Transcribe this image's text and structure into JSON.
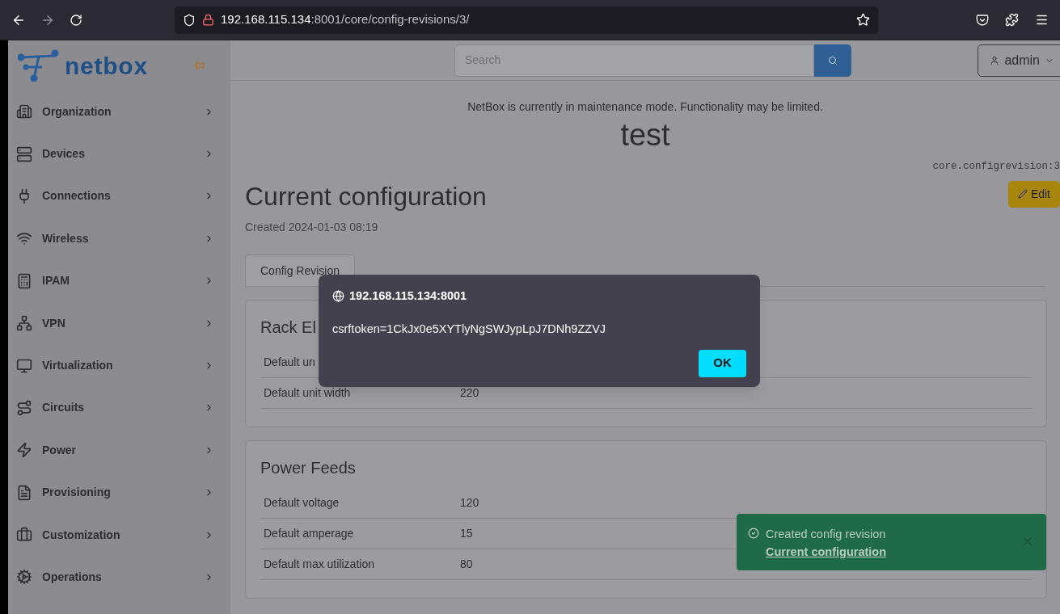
{
  "browser": {
    "url_host": "192.168.115.134",
    "url_rest": ":8001/core/config-revisions/3/"
  },
  "header": {
    "search_placeholder": "Search",
    "user": "admin"
  },
  "sidebar": {
    "brand": "netbox",
    "items": [
      {
        "label": "Organization"
      },
      {
        "label": "Devices"
      },
      {
        "label": "Connections"
      },
      {
        "label": "Wireless"
      },
      {
        "label": "IPAM"
      },
      {
        "label": "VPN"
      },
      {
        "label": "Virtualization"
      },
      {
        "label": "Circuits"
      },
      {
        "label": "Power"
      },
      {
        "label": "Provisioning"
      },
      {
        "label": "Customization"
      },
      {
        "label": "Operations"
      }
    ]
  },
  "banner": "NetBox is currently in maintenance mode. Functionality may be limited.",
  "site_title": "test",
  "object_id": "core.configrevision:3",
  "edit_button": "Edit",
  "title": "Current configuration",
  "created": "Created 2024-01-03 08:19",
  "tabs": [
    {
      "label": "Config Revision",
      "selected": true
    }
  ],
  "cards": [
    {
      "title": "Rack El",
      "rows": [
        {
          "label": "Default un"
        },
        {
          "label": "Default unit width",
          "value": "220"
        }
      ]
    },
    {
      "title": "Power Feeds",
      "rows": [
        {
          "label": "Default voltage",
          "value": "120"
        },
        {
          "label": "Default amperage",
          "value": "15"
        },
        {
          "label": "Default max utilization",
          "value": "80"
        }
      ]
    }
  ],
  "dialog": {
    "origin": "192.168.115.134:8001",
    "message": "csrftoken=1CkJx0e5XYTlyNgSWJypLpJ7DNh9ZZVJ",
    "button": "OK"
  },
  "toast": {
    "text": "Created config revision ",
    "link": "Current configuration"
  }
}
